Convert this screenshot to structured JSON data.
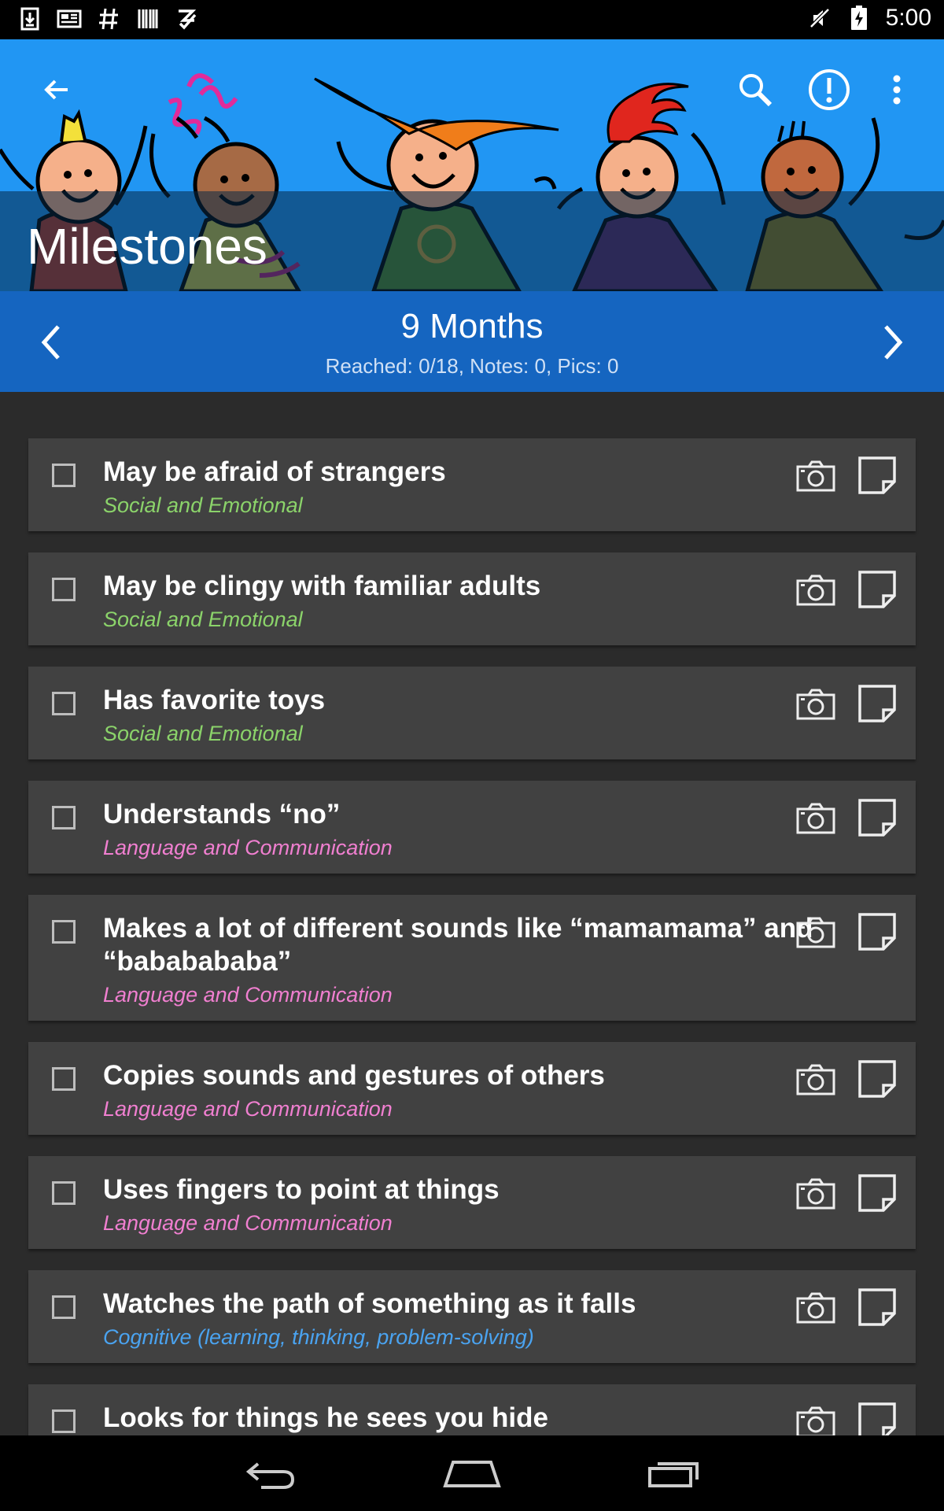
{
  "status_bar": {
    "time": "5:00",
    "icons_left": [
      "download-icon",
      "news-icon",
      "hashtag-icon",
      "barcode-icon",
      "checklist-icon"
    ],
    "icons_right": [
      "mute-icon",
      "battery-charging-icon"
    ]
  },
  "header": {
    "title": "Milestones",
    "actions": [
      "back-icon",
      "search-icon",
      "alert-icon",
      "more-icon"
    ],
    "background_color": "#2196F3"
  },
  "month_nav": {
    "title": "9 Months",
    "summary": "Reached: 0/18, Notes: 0, Pics: 0",
    "background_color": "#1565C0"
  },
  "category_colors": {
    "social": "#8BD36A",
    "language": "#F07FD0",
    "cognitive": "#4AA3F0"
  },
  "milestones": [
    {
      "title": "May be afraid of strangers",
      "category": "Social and Emotional",
      "checked": false
    },
    {
      "title": "May be clingy with familiar adults",
      "category": "Social and Emotional",
      "checked": false
    },
    {
      "title": "Has favorite toys",
      "category": "Social and Emotional",
      "checked": false
    },
    {
      "title": "Understands “no”",
      "category": "Language and Communication",
      "checked": false
    },
    {
      "title": "Makes a lot of different sounds like “mamamama” and “bababababa”",
      "category": "Language and Communication",
      "checked": false
    },
    {
      "title": "Copies sounds and gestures of others",
      "category": "Language and Communication",
      "checked": false
    },
    {
      "title": "Uses fingers to point at things",
      "category": "Language and Communication",
      "checked": false
    },
    {
      "title": "Watches the path of something as it falls",
      "category": "Cognitive (learning, thinking, problem-solving)",
      "checked": false
    },
    {
      "title": "Looks for things he sees you hide",
      "category": "",
      "checked": false
    }
  ],
  "nav_bar": [
    "back-nav-icon",
    "home-nav-icon",
    "recents-nav-icon"
  ]
}
